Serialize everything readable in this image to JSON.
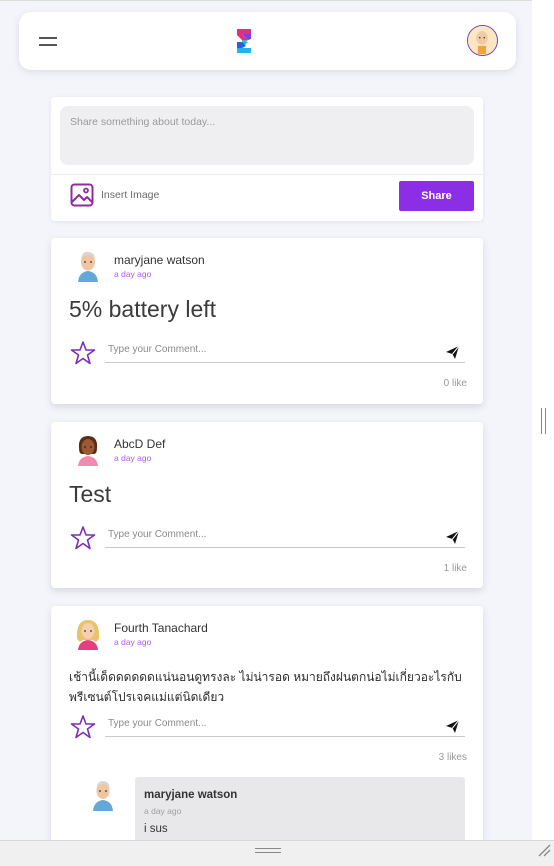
{
  "composer": {
    "placeholder": "Share something about today...",
    "insert_image_label": "Insert Image",
    "share_label": "Share"
  },
  "comment_placeholder": "Type your Comment...",
  "posts": [
    {
      "author": "maryjane watson",
      "time": "a day ago",
      "text": "5% battery left",
      "likes": "0 like"
    },
    {
      "author": "AbcD Def",
      "time": "a day ago",
      "text": "Test",
      "likes": "1 like"
    },
    {
      "author": "Fourth Tanachard",
      "time": "a day ago",
      "text": "เช้านี้เด็ดดดดดดแน่นอนดูทรงละ ไม่น่ารอด หมายถึงฝนตกน่อไม่เกี่ยวอะไรกับพรีเซนต์โปรเจคแม่แต่นิดเดียว",
      "likes": "3 likes",
      "reply": {
        "author": "maryjane watson",
        "time": "a day ago",
        "text": "i sus"
      }
    }
  ],
  "icons": {
    "menu": "hamburger-menu-icon",
    "logo": "app-logo",
    "avatar": "user-avatar",
    "image": "image-icon",
    "star": "star-outline-icon",
    "send": "send-icon"
  },
  "colors": {
    "accent": "#8c2ee6",
    "timestamp": "#b05be6",
    "background": "#f4f5fb"
  }
}
